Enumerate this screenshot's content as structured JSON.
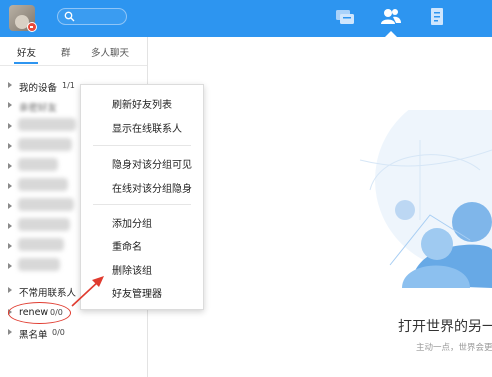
{
  "colors": {
    "accent": "#2d95f0",
    "annotation": "#e03b2f"
  },
  "topbar": {
    "avatar": "user-avatar",
    "status": "do-not-disturb",
    "nav": [
      "chat-icon",
      "contacts-icon",
      "space-icon"
    ],
    "active_nav": "contacts-icon"
  },
  "tabs": [
    {
      "label": "好友",
      "active": true
    },
    {
      "label": "群",
      "active": false
    },
    {
      "label": "多人聊天",
      "active": false
    }
  ],
  "groups": {
    "my_devices": {
      "label": "我的设备",
      "count": "1/1"
    },
    "obscured_1": {
      "label": "亲密好友"
    },
    "strangers": {
      "label": "不常用联系人"
    },
    "renew": {
      "label": "renew",
      "count": "0/0"
    },
    "blacklist": {
      "label": "黑名单",
      "count": "0/0"
    }
  },
  "context_menu": {
    "items": [
      "刷新好友列表",
      "显示在线联系人",
      "隐身对该分组可见",
      "在线对该分组隐身",
      "添加分组",
      "重命名",
      "删除该组",
      "好友管理器"
    ]
  },
  "main": {
    "title": "打开世界的另一",
    "subtitle": "主动一点，世界会更"
  }
}
